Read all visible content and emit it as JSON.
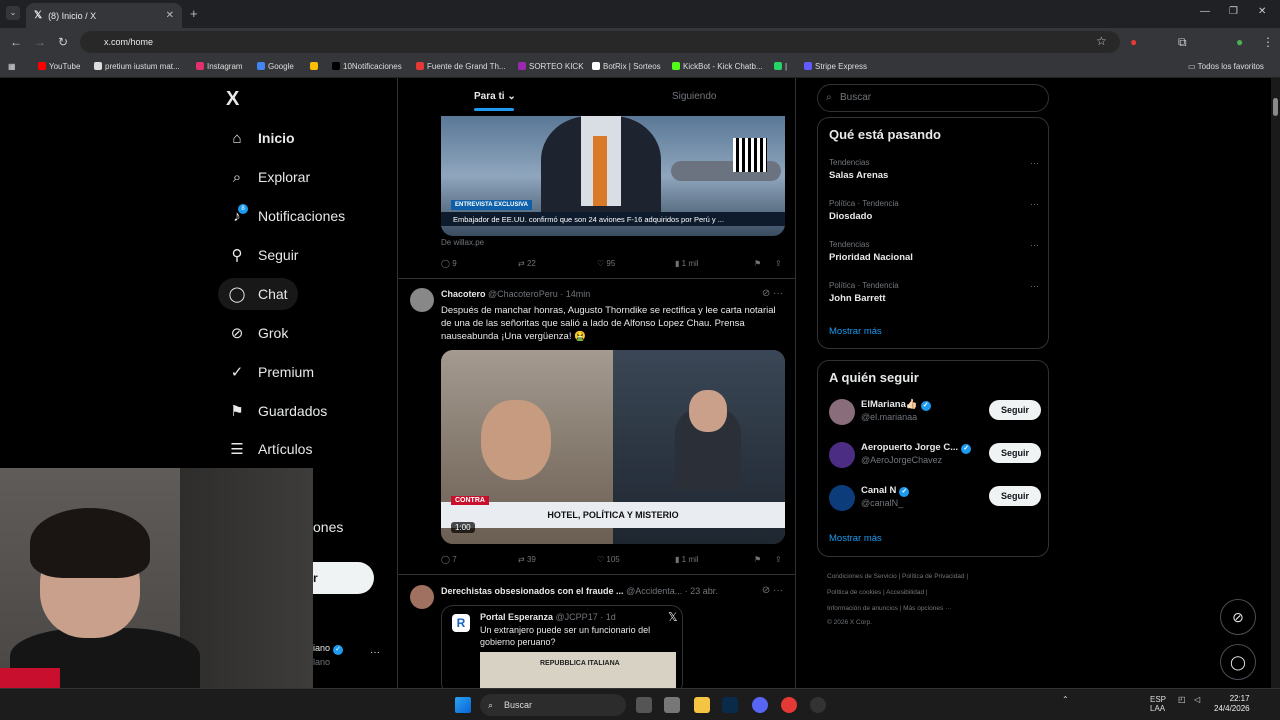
{
  "browser": {
    "tab_title": "(8) Inicio / X",
    "url": "x.com/home",
    "bookmarks": [
      {
        "label": "YouTube",
        "color": "#ff0000"
      },
      {
        "label": "pretium iustum mat...",
        "color": "#dddddd"
      },
      {
        "label": "Instagram",
        "color": "#e1306c"
      },
      {
        "label": "Google",
        "color": "#4285f4"
      },
      {
        "label": "",
        "color": "#fbbc05"
      },
      {
        "label": "10Notificaciones",
        "color": "#000000"
      },
      {
        "label": "Fuente de Grand Th...",
        "color": "#e53935"
      },
      {
        "label": "SORTEO KICK",
        "color": "#9c27b0"
      },
      {
        "label": "BotRix | Sorteos",
        "color": "#ffffff"
      },
      {
        "label": "KickBot - Kick Chatb...",
        "color": "#53fc18"
      },
      {
        "label": "|",
        "color": "#25d366"
      },
      {
        "label": "Stripe Express",
        "color": "#635bff"
      }
    ],
    "all_bookmarks": "Todos los favoritos"
  },
  "sidebar": {
    "logo": "X",
    "items": [
      {
        "label": "Inicio",
        "icon": "home-icon",
        "glyph": "⌂"
      },
      {
        "label": "Explorar",
        "icon": "search-icon",
        "glyph": "⌕"
      },
      {
        "label": "Notificaciones",
        "icon": "bell-icon",
        "glyph": "♪"
      },
      {
        "label": "Seguir",
        "icon": "follow-icon",
        "glyph": "⚲"
      },
      {
        "label": "Chat",
        "icon": "chat-icon",
        "glyph": "◯"
      },
      {
        "label": "Grok",
        "icon": "grok-icon",
        "glyph": "⊘"
      },
      {
        "label": "Premium",
        "icon": "premium-icon",
        "glyph": "✓"
      },
      {
        "label": "Guardados",
        "icon": "bookmark-icon",
        "glyph": "⚑"
      },
      {
        "label": "Artículos",
        "icon": "article-icon",
        "glyph": "☰"
      }
    ],
    "partial_more": "ones",
    "partial_post": "r",
    "partial_account_name": "iano",
    "partial_account_handle": "lano",
    "notification_badge": "8"
  },
  "feed": {
    "tabs": [
      "Para ti",
      "Siguiendo"
    ],
    "post1": {
      "tag": "ENTREVISTA EXCLUSIVA",
      "caption": "Embajador de EE.UU. confirmó que son 24 aviones F-16 adquiridos por Perú y ...",
      "source": "De willax.pe",
      "replies": "9",
      "reposts": "22",
      "likes": "95",
      "views": "1 mil"
    },
    "post2": {
      "name": "Chacotero",
      "handle": "@ChacoteroPeru",
      "time": "14min",
      "text": "Después de manchar honras, Augusto Thorndike se rectifica y lee carta notarial de una de las señoritas que salió a lado de Alfonso Lopez Chau. Prensa nauseabunda ¡Una vergüenza! 🤮",
      "media_tag": "CONTRA",
      "media_banner": "HOTEL, POLÍTICA Y MISTERIO",
      "duration": "1:00",
      "replies": "7",
      "reposts": "39",
      "likes": "105",
      "views": "1 mil"
    },
    "post3": {
      "name": "Derechistas obsesionados con el fraude ...",
      "handle": "@Accidenta...",
      "time": "23 abr.",
      "quote_name": "Portal Esperanza",
      "quote_handle": "@JCPP17",
      "quote_time": "1d",
      "quote_text": "Un extranjero puede ser un funcionario del gobierno peruano?",
      "quote_image_text": "REPUBBLICA ITALIANA"
    }
  },
  "right": {
    "search_placeholder": "Buscar",
    "trends_title": "Qué está pasando",
    "trends": [
      {
        "category": "Tendencias",
        "name": "Salas Arenas"
      },
      {
        "category": "Política · Tendencia",
        "name": "Diosdado"
      },
      {
        "category": "Tendencias",
        "name": "Prioridad Nacional"
      },
      {
        "category": "Política · Tendencia",
        "name": "John Barrett"
      }
    ],
    "show_more": "Mostrar más",
    "follow_title": "A quién seguir",
    "follow": [
      {
        "name": "ElMariana👍🏻",
        "handle": "@el.marianaa",
        "button": "Seguir",
        "color": "#8a6d7a"
      },
      {
        "name": "Aeropuerto Jorge C...",
        "handle": "@AeroJorgeChavez",
        "button": "Seguir",
        "color": "#4b2e83"
      },
      {
        "name": "Canal N",
        "handle": "@canalN_",
        "button": "Seguir",
        "color": "#0c3c7a"
      }
    ],
    "footer_line1": "Condiciones de Servicio   |   Política de Privacidad   |",
    "footer_line2": "Política de cookies   |   Accesibilidad   |",
    "footer_line3": "Información de anuncios   |   Más opciones ···",
    "footer_line4": "© 2026 X Corp."
  },
  "taskbar": {
    "search": "Buscar",
    "lang": "ESP",
    "lang2": "LAA",
    "time": "22:17",
    "date": "24/4/2026"
  }
}
